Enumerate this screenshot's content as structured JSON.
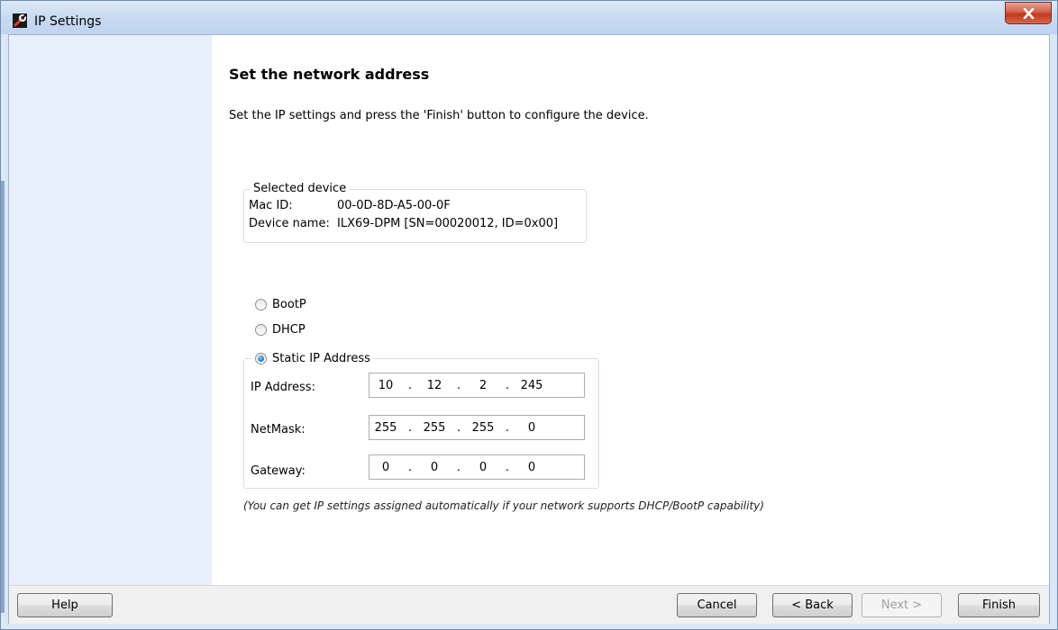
{
  "window": {
    "title": "IP Settings"
  },
  "main": {
    "heading": "Set the network address",
    "description": "Set the IP settings and press the 'Finish' button to configure the device."
  },
  "selected_device": {
    "legend": "Selected device",
    "mac_label": "Mac ID:",
    "mac_value": "00-0D-8D-A5-00-0F",
    "name_label": "Device name:",
    "name_value": "ILX69-DPM [SN=00020012, ID=0x00]"
  },
  "mode": {
    "options": [
      {
        "label": "BootP",
        "checked": false
      },
      {
        "label": "DHCP",
        "checked": false
      },
      {
        "label": "Static IP Address",
        "checked": true
      }
    ]
  },
  "static_ip": {
    "ip_label": "IP Address:",
    "ip_octets": [
      "10",
      "12",
      "2",
      "245"
    ],
    "netmask_label": "NetMask:",
    "netmask_octets": [
      "255",
      "255",
      "255",
      "0"
    ],
    "gateway_label": "Gateway:",
    "gateway_octets": [
      "0",
      "0",
      "0",
      "0"
    ],
    "separator": "."
  },
  "hint": "(You can get IP settings assigned automatically if your network supports DHCP/BootP capability)",
  "footer": {
    "help_label": "Help",
    "cancel_label": "Cancel",
    "back_label": "< Back",
    "next_label": "Next >",
    "finish_label": "Finish"
  },
  "colors": {
    "title_bar": "#c8daf1",
    "sidebar": "#e6effa",
    "close_button": "#c0381e",
    "radio_checked": "#2a86d8"
  }
}
